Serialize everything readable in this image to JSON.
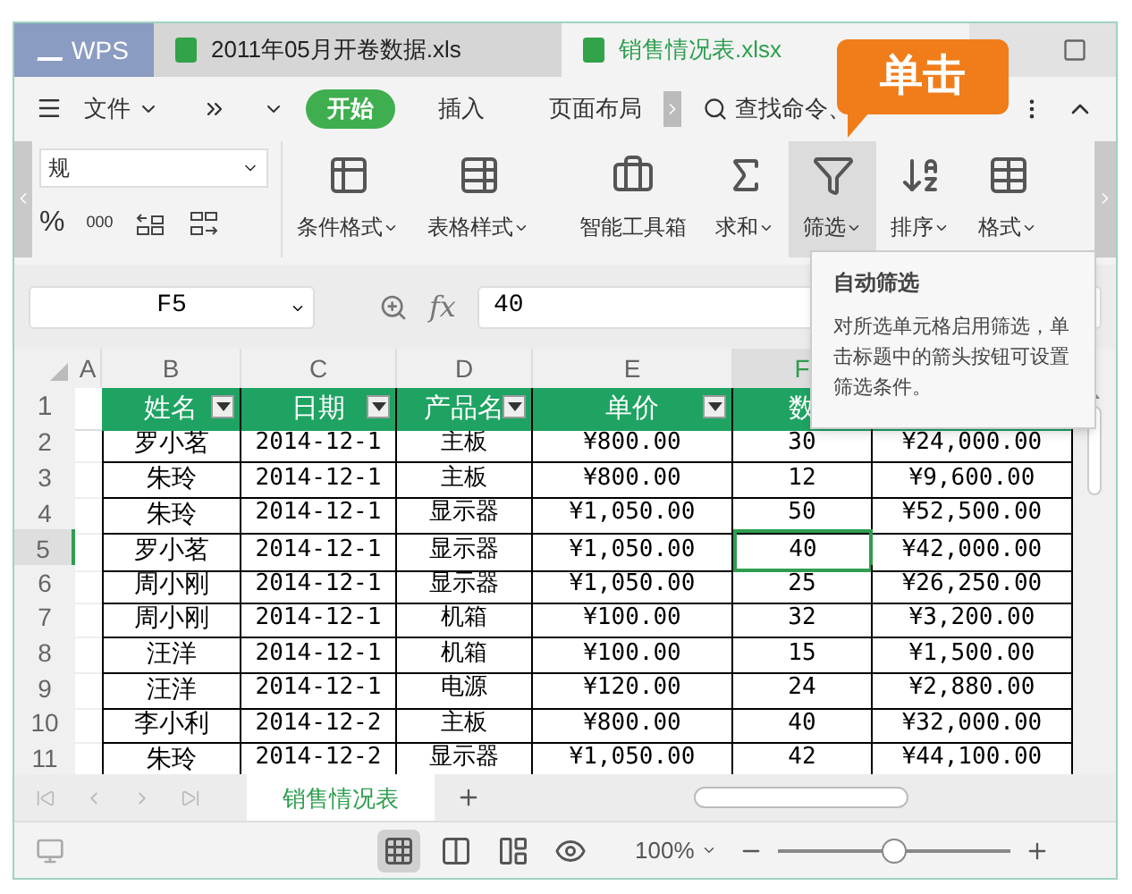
{
  "tabs": [
    {
      "label": "WPS",
      "kind": "app",
      "selected": false
    },
    {
      "label": "2011年05月开卷数据.xls",
      "kind": "file",
      "selected": false
    },
    {
      "label": "销售情况表.xlsx",
      "kind": "file",
      "selected": true
    }
  ],
  "callout": {
    "text": "单击"
  },
  "menu": {
    "file": "文件",
    "tabs": [
      {
        "label": "开始",
        "selected": true
      },
      {
        "label": "插入",
        "selected": false
      },
      {
        "label": "页面布局",
        "selected": false
      }
    ],
    "search": "查找命令、"
  },
  "ribbon": {
    "number_format": "规",
    "number_buttons": [
      "%",
      "000"
    ],
    "tools": [
      {
        "label": "条件格式",
        "kind": "conditional",
        "dropdown": true,
        "selected": false
      },
      {
        "label": "表格样式",
        "kind": "table-style",
        "dropdown": true,
        "selected": false
      },
      {
        "label": "智能工具箱",
        "kind": "toolbox",
        "dropdown": false,
        "selected": false
      },
      {
        "label": "求和",
        "kind": "sum",
        "dropdown": true,
        "selected": false
      },
      {
        "label": "筛选",
        "kind": "filter",
        "dropdown": true,
        "selected": true
      },
      {
        "label": "排序",
        "kind": "sort",
        "dropdown": true,
        "selected": false
      },
      {
        "label": "格式",
        "kind": "format",
        "dropdown": true,
        "selected": false
      }
    ]
  },
  "tooltip": {
    "title": "自动筛选",
    "body": "对所选单元格启用筛选，单击标题中的箭头按钮可设置筛选条件。"
  },
  "formula_bar": {
    "cell": "F5",
    "fx": "fx",
    "value": "40"
  },
  "sheet": {
    "corner_column": "A",
    "columns": [
      {
        "label": "B",
        "selected": false
      },
      {
        "label": "C",
        "selected": false
      },
      {
        "label": "D",
        "selected": false
      },
      {
        "label": "E",
        "selected": false
      },
      {
        "label": "F",
        "selected": true
      }
    ],
    "header_row": {
      "number": "1",
      "cells": [
        "姓名",
        "日期",
        "产品名",
        "单价",
        "数"
      ]
    },
    "rows": [
      {
        "number": "2",
        "selected": false,
        "cells": [
          {
            "text": "罗小茗",
            "selected": false
          },
          {
            "text": "2014-12-1",
            "selected": false
          },
          {
            "text": "主板",
            "selected": false
          },
          {
            "text": "¥800.00",
            "selected": false
          },
          {
            "text": "30",
            "selected": false
          },
          {
            "text": "¥24,000.00",
            "selected": false
          }
        ]
      },
      {
        "number": "3",
        "selected": false,
        "cells": [
          {
            "text": "朱玲",
            "selected": false
          },
          {
            "text": "2014-12-1",
            "selected": false
          },
          {
            "text": "主板",
            "selected": false
          },
          {
            "text": "¥800.00",
            "selected": false
          },
          {
            "text": "12",
            "selected": false
          },
          {
            "text": "¥9,600.00",
            "selected": false
          }
        ]
      },
      {
        "number": "4",
        "selected": false,
        "cells": [
          {
            "text": "朱玲",
            "selected": false
          },
          {
            "text": "2014-12-1",
            "selected": false
          },
          {
            "text": "显示器",
            "selected": false
          },
          {
            "text": "¥1,050.00",
            "selected": false
          },
          {
            "text": "50",
            "selected": false
          },
          {
            "text": "¥52,500.00",
            "selected": false
          }
        ]
      },
      {
        "number": "5",
        "selected": true,
        "cells": [
          {
            "text": "罗小茗",
            "selected": false
          },
          {
            "text": "2014-12-1",
            "selected": false
          },
          {
            "text": "显示器",
            "selected": false
          },
          {
            "text": "¥1,050.00",
            "selected": false
          },
          {
            "text": "40",
            "selected": true
          },
          {
            "text": "¥42,000.00",
            "selected": false
          }
        ]
      },
      {
        "number": "6",
        "selected": false,
        "cells": [
          {
            "text": "周小刚",
            "selected": false
          },
          {
            "text": "2014-12-1",
            "selected": false
          },
          {
            "text": "显示器",
            "selected": false
          },
          {
            "text": "¥1,050.00",
            "selected": false
          },
          {
            "text": "25",
            "selected": false
          },
          {
            "text": "¥26,250.00",
            "selected": false
          }
        ]
      },
      {
        "number": "7",
        "selected": false,
        "cells": [
          {
            "text": "周小刚",
            "selected": false
          },
          {
            "text": "2014-12-1",
            "selected": false
          },
          {
            "text": "机箱",
            "selected": false
          },
          {
            "text": "¥100.00",
            "selected": false
          },
          {
            "text": "32",
            "selected": false
          },
          {
            "text": "¥3,200.00",
            "selected": false
          }
        ]
      },
      {
        "number": "8",
        "selected": false,
        "cells": [
          {
            "text": "汪洋",
            "selected": false
          },
          {
            "text": "2014-12-1",
            "selected": false
          },
          {
            "text": "机箱",
            "selected": false
          },
          {
            "text": "¥100.00",
            "selected": false
          },
          {
            "text": "15",
            "selected": false
          },
          {
            "text": "¥1,500.00",
            "selected": false
          }
        ]
      },
      {
        "number": "9",
        "selected": false,
        "cells": [
          {
            "text": "汪洋",
            "selected": false
          },
          {
            "text": "2014-12-1",
            "selected": false
          },
          {
            "text": "电源",
            "selected": false
          },
          {
            "text": "¥120.00",
            "selected": false
          },
          {
            "text": "24",
            "selected": false
          },
          {
            "text": "¥2,880.00",
            "selected": false
          }
        ]
      },
      {
        "number": "10",
        "selected": false,
        "cells": [
          {
            "text": "李小利",
            "selected": false
          },
          {
            "text": "2014-12-2",
            "selected": false
          },
          {
            "text": "主板",
            "selected": false
          },
          {
            "text": "¥800.00",
            "selected": false
          },
          {
            "text": "40",
            "selected": false
          },
          {
            "text": "¥32,000.00",
            "selected": false
          }
        ]
      },
      {
        "number": "11",
        "selected": false,
        "cells": [
          {
            "text": "朱玲",
            "selected": false
          },
          {
            "text": "2014-12-2",
            "selected": false
          },
          {
            "text": "显示器",
            "selected": false
          },
          {
            "text": "¥1,050.00",
            "selected": false
          },
          {
            "text": "42",
            "selected": false
          },
          {
            "text": "¥44,100.00",
            "selected": false
          }
        ]
      }
    ]
  },
  "sheet_tabs": [
    {
      "label": "销售情况表",
      "selected": true
    }
  ],
  "status_bar": {
    "views": [
      {
        "kind": "normal",
        "selected": true
      },
      {
        "kind": "page-break",
        "selected": false
      },
      {
        "kind": "layout",
        "selected": false
      },
      {
        "kind": "eye",
        "selected": false
      }
    ],
    "zoom": "100%",
    "zoom_slider": {
      "level": 0.5
    }
  }
}
